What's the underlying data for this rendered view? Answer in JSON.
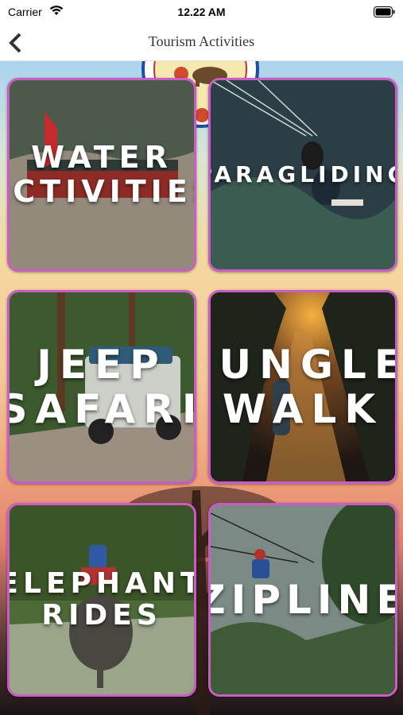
{
  "status_bar": {
    "carrier": "Carrier",
    "time": "12.22 AM"
  },
  "nav": {
    "title": "Tourism Activities",
    "back_icon": "chevron-left-icon"
  },
  "background": {
    "logo_name": "tourism-logo",
    "tree_name": "tree-silhouette"
  },
  "activities": [
    {
      "label": "WATER\nACTIVITIES",
      "accent": "#8a8f88"
    },
    {
      "label": "PARAGLIDING",
      "accent": "#2c3f49"
    },
    {
      "label": "JEEP\nSAFARI",
      "accent": "#4a6a3a"
    },
    {
      "label": "JUNGLE\nWALK",
      "accent": "#3d2a1f"
    },
    {
      "label": "ELEPHANT\nRIDES",
      "accent": "#4f6b3a"
    },
    {
      "label": "ZIPLINE",
      "accent": "#6a7d70"
    }
  ],
  "colors": {
    "card_border": "#c95cc5"
  }
}
